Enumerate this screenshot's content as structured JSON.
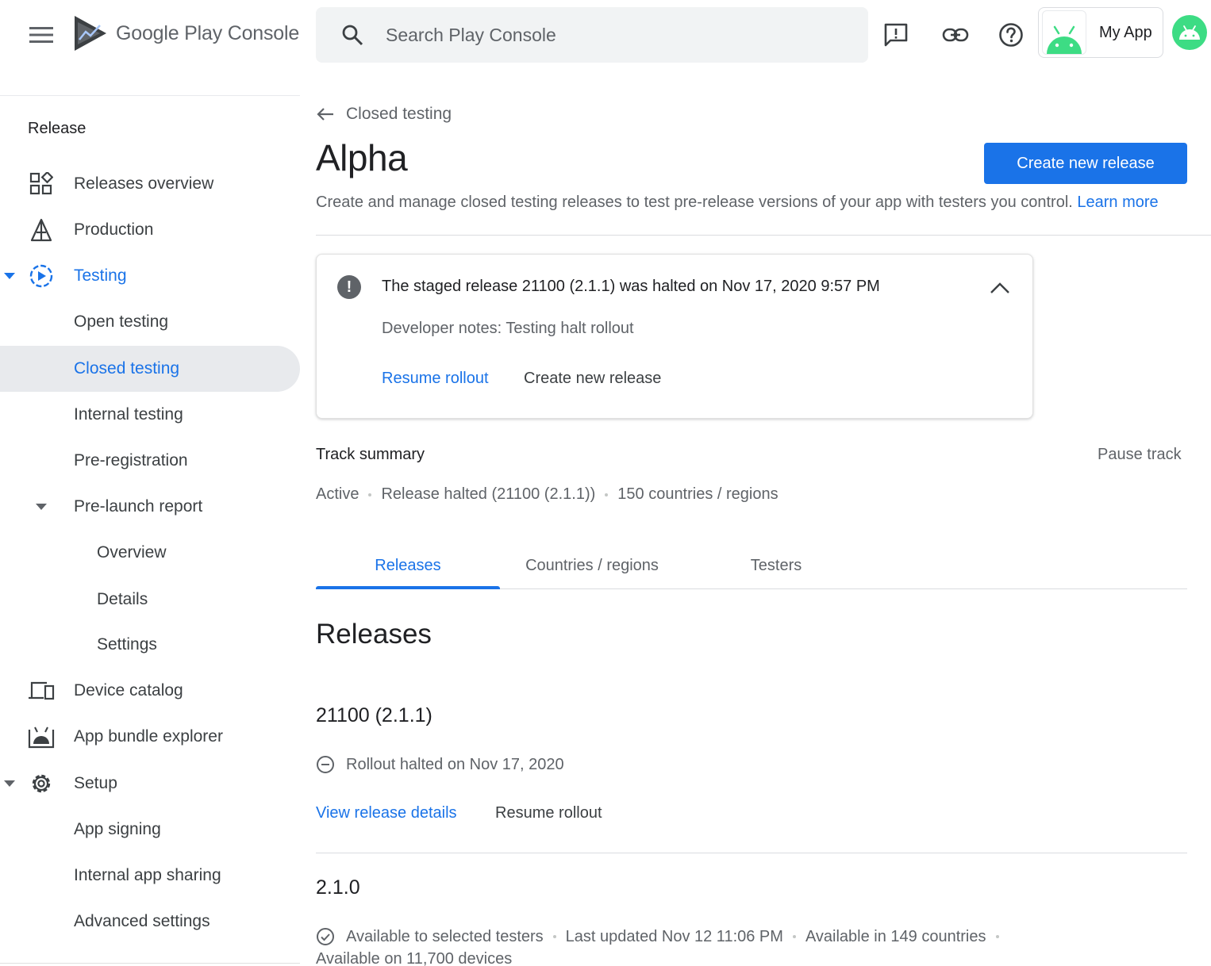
{
  "topbar": {
    "brand": "Google Play Console",
    "search_placeholder": "Search Play Console",
    "app_name": "My App"
  },
  "sidebar": {
    "section": "Release",
    "items": [
      {
        "label": "Releases overview"
      },
      {
        "label": "Production"
      },
      {
        "label": "Testing"
      },
      {
        "label": "Open testing"
      },
      {
        "label": "Closed testing"
      },
      {
        "label": "Internal testing"
      },
      {
        "label": "Pre-registration"
      },
      {
        "label": "Pre-launch report"
      },
      {
        "label": "Overview"
      },
      {
        "label": "Details"
      },
      {
        "label": "Settings"
      },
      {
        "label": "Device catalog"
      },
      {
        "label": "App bundle explorer"
      },
      {
        "label": "Setup"
      },
      {
        "label": "App signing"
      },
      {
        "label": "Internal app sharing"
      },
      {
        "label": "Advanced settings"
      }
    ]
  },
  "main": {
    "back_label": "Closed testing",
    "title": "Alpha",
    "create_button": "Create new release",
    "description": "Create and manage closed testing releases to test pre-release versions of your app with testers you control.",
    "learn_more": "Learn more",
    "alert": {
      "title": "The staged release 21100 (2.1.1) was halted on Nov 17, 2020 9:57 PM",
      "notes": "Developer notes: Testing halt rollout",
      "resume": "Resume rollout",
      "create": "Create new release"
    },
    "track": {
      "title": "Track summary",
      "pause": "Pause track",
      "status": "Active",
      "release": "Release halted (21100 (2.1.1))",
      "countries": "150 countries / regions"
    },
    "tabs": [
      {
        "label": "Releases"
      },
      {
        "label": "Countries / regions"
      },
      {
        "label": "Testers"
      }
    ],
    "releases_title": "Releases",
    "releases": [
      {
        "name": "21100 (2.1.1)",
        "status": "Rollout halted on Nov 17, 2020",
        "view_details": "View release details",
        "resume": "Resume rollout"
      },
      {
        "name": "2.1.0",
        "status": "Available to selected testers",
        "updated": "Last updated Nov 12 11:06 PM",
        "countries": "Available in 149 countries",
        "devices": "Available on 11,700 devices"
      }
    ]
  },
  "colors": {
    "accent": "#1a73e8",
    "android_green": "#3ddc84",
    "active_nav_bg": "#e8eaed"
  },
  "icons": {
    "menu": "hamburger-icon",
    "search": "search-icon",
    "feedback": "feedback-icon",
    "link": "link-icon",
    "help": "help-icon",
    "back": "arrow-back-icon",
    "collapse": "chevron-up-icon",
    "alert": "error-icon"
  }
}
